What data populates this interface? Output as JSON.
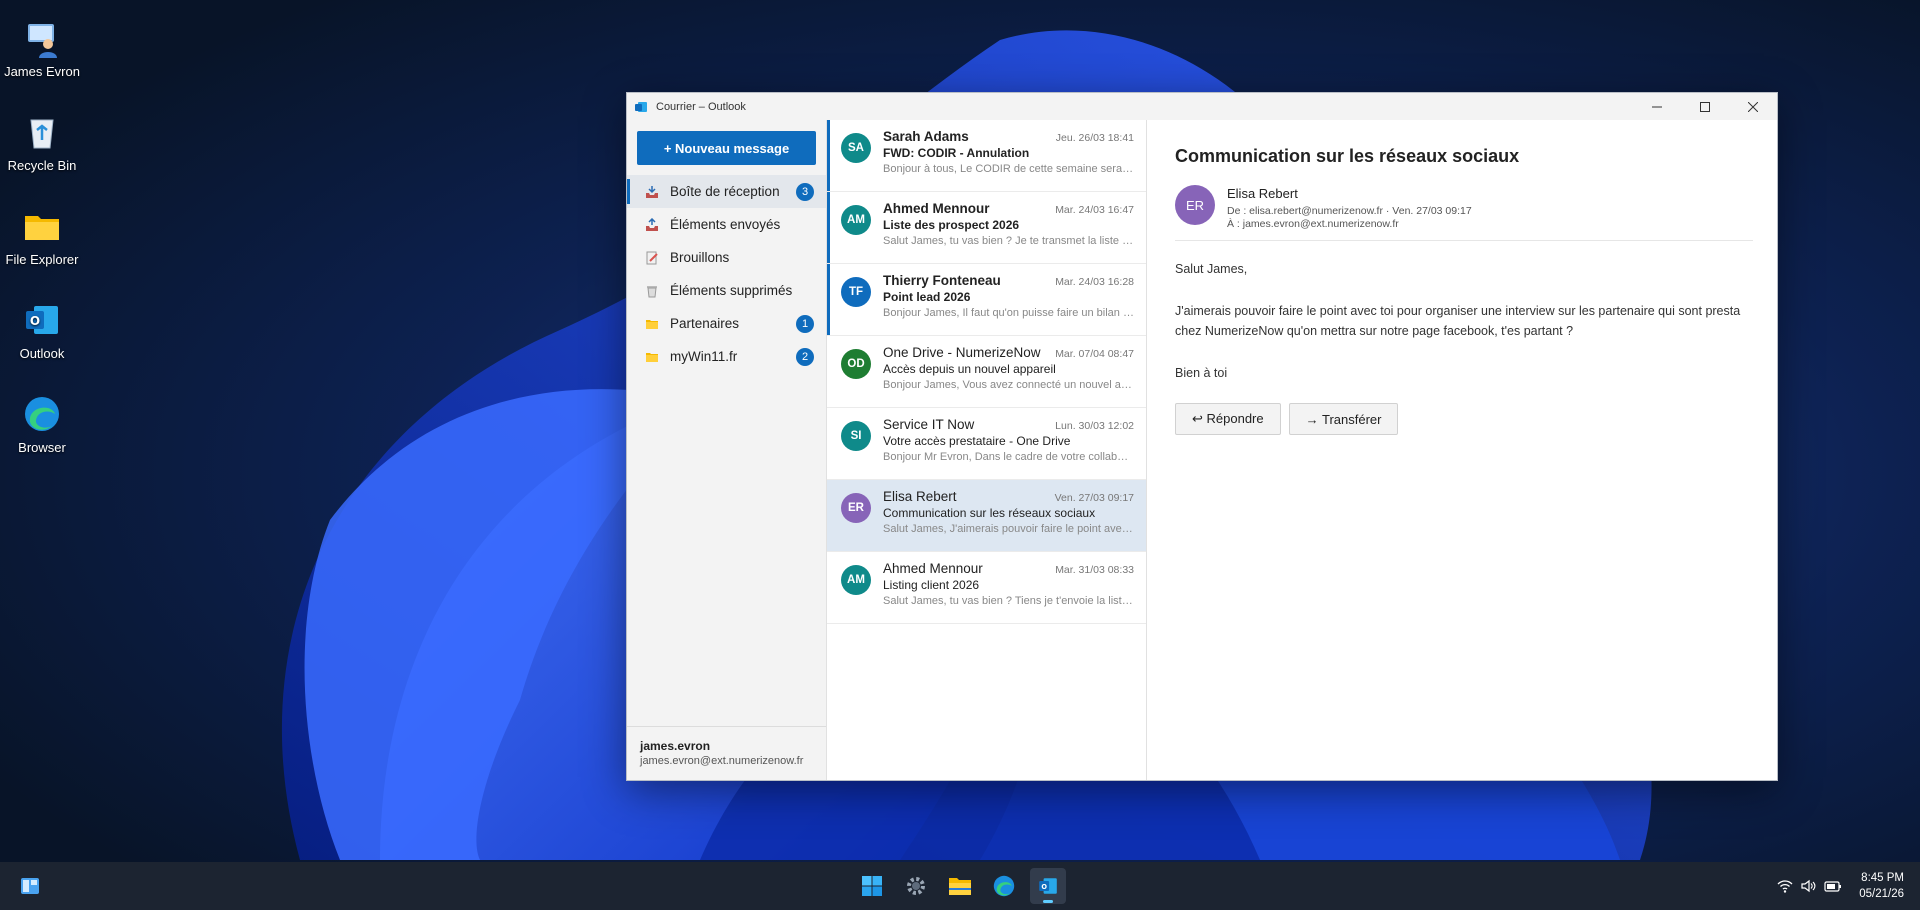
{
  "desktop": {
    "icons": [
      {
        "label": "James Evron",
        "icon": "user-computer-icon"
      },
      {
        "label": "Recycle Bin",
        "icon": "recycle-bin-icon"
      },
      {
        "label": "File Explorer",
        "icon": "folder-icon"
      },
      {
        "label": "Outlook",
        "icon": "outlook-icon"
      },
      {
        "label": "Browser",
        "icon": "edge-icon"
      }
    ]
  },
  "window": {
    "title": "Courrier – Outlook",
    "accent": "#0f6cbd"
  },
  "nav": {
    "new_message": "+ Nouveau message",
    "folders": [
      {
        "label": "Boîte de réception",
        "count": "3",
        "icon": "inbox-icon"
      },
      {
        "label": "Éléments envoyés",
        "count": "",
        "icon": "sent-icon"
      },
      {
        "label": "Brouillons",
        "count": "",
        "icon": "draft-icon"
      },
      {
        "label": "Éléments supprimés",
        "count": "",
        "icon": "trash-icon"
      },
      {
        "label": "Partenaires",
        "count": "1",
        "icon": "folder-icon"
      },
      {
        "label": "myWin11.fr",
        "count": "2",
        "icon": "folder-icon"
      }
    ],
    "account": {
      "name": "james.evron",
      "email": "james.evron@ext.numerizenow.fr"
    }
  },
  "messages": [
    {
      "initials": "SA",
      "color": "#0f8a8a",
      "from": "Sarah Adams",
      "date": "Jeu. 26/03 18:41",
      "subject": "FWD: CODIR - Annulation",
      "preview": "Bonjour à tous, Le CODIR de cette semaine sera a...",
      "unread": true
    },
    {
      "initials": "AM",
      "color": "#0f8a8a",
      "from": "Ahmed Mennour",
      "date": "Mar. 24/03 16:47",
      "subject": "Liste des prospect 2026",
      "preview": "Salut James, tu vas bien ? Je te transmet la liste de...",
      "unread": true
    },
    {
      "initials": "TF",
      "color": "#0f6cbd",
      "from": "Thierry Fonteneau",
      "date": "Mar. 24/03 16:28",
      "subject": "Point lead 2026",
      "preview": "Bonjour James, Il faut qu'on puisse faire un bilan a...",
      "unread": true
    },
    {
      "initials": "OD",
      "color": "#1e7d32",
      "from": "One Drive - NumerizeNow",
      "date": "Mar. 07/04 08:47",
      "subject": "Accès depuis un nouvel appareil",
      "preview": "Bonjour James, Vous avez connecté un nouvel ap...",
      "unread": false
    },
    {
      "initials": "SI",
      "color": "#0f8a8a",
      "from": "Service IT Now",
      "date": "Lun. 30/03 12:02",
      "subject": "Votre accès prestataire - One Drive",
      "preview": "Bonjour Mr Evron, Dans le cadre de votre collabor...",
      "unread": false
    },
    {
      "initials": "ER",
      "color": "#8764b8",
      "from": "Elisa Rebert",
      "date": "Ven. 27/03 09:17",
      "subject": "Communication sur les réseaux sociaux",
      "preview": "Salut James, J'aimerais pouvoir faire le point avec ...",
      "unread": false,
      "selected": true
    },
    {
      "initials": "AM",
      "color": "#0f8a8a",
      "from": "Ahmed Mennour",
      "date": "Mar. 31/03 08:33",
      "subject": "Listing client 2026",
      "preview": "Salut James, tu vas bien ? Tiens je t'envoie la liste ...",
      "unread": false
    }
  ],
  "reader": {
    "subject": "Communication sur les réseaux sociaux",
    "initials": "ER",
    "avatar_color": "#8764b8",
    "sender_name": "Elisa Rebert",
    "from_line": "De : elisa.rebert@numerizenow.fr  ·  Ven. 27/03 09:17",
    "to_line": "À : james.evron@ext.numerizenow.fr",
    "body": [
      "Salut James,",
      "J'aimerais pouvoir faire le point avec toi pour organiser une interview sur les partenaire qui sont presta chez NumerizeNow qu'on mettra sur notre page facebook, t'es partant ?",
      "Bien à toi"
    ],
    "reply": "↩ Répondre",
    "forward": "→ Transférer"
  },
  "taskbar": {
    "time": "8:45 PM",
    "date": "05/21/26"
  }
}
